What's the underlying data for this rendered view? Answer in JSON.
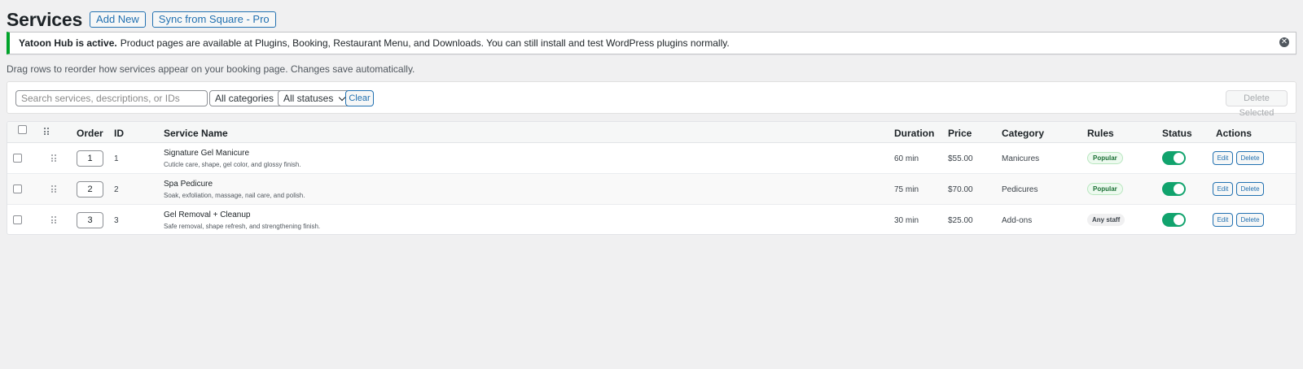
{
  "header": {
    "title": "Services",
    "add_new": "Add New",
    "sync": "Sync from Square - Pro"
  },
  "notice": {
    "strong": "Yatoon Hub is active.",
    "text": "Product pages are available at Plugins, Booking, Restaurant Menu, and Downloads. You can still install and test WordPress plugins normally.",
    "dismiss_glyph": "✕",
    "accent": "#00a32a"
  },
  "help_text": "Drag rows to reorder how services appear on your booking page. Changes save automatically.",
  "filters": {
    "search_placeholder": "Search services, descriptions, or IDs",
    "category": "All categories",
    "status": "All statuses",
    "clear": "Clear",
    "delete_selected": "Delete Selected"
  },
  "table": {
    "columns": {
      "order": "Order",
      "id": "ID",
      "name": "Service Name",
      "duration": "Duration",
      "price": "Price",
      "category": "Category",
      "rules": "Rules",
      "status": "Status",
      "actions": "Actions"
    },
    "rows": [
      {
        "order": "1",
        "id": "1",
        "name": "Signature Gel Manicure",
        "description": "Cuticle care, shape, gel color, and glossy finish.",
        "duration": "60 min",
        "price": "$55.00",
        "category": "Manicures",
        "rule": "Popular",
        "status_on": true,
        "edit": "Edit",
        "delete": "Delete"
      },
      {
        "order": "2",
        "id": "2",
        "name": "Spa Pedicure",
        "description": "Soak, exfoliation, massage, nail care, and polish.",
        "duration": "75 min",
        "price": "$70.00",
        "category": "Pedicures",
        "rule": "Popular",
        "status_on": true,
        "edit": "Edit",
        "delete": "Delete"
      },
      {
        "order": "3",
        "id": "3",
        "name": "Gel Removal + Cleanup",
        "description": "Safe removal, shape refresh, and strengthening finish.",
        "duration": "30 min",
        "price": "$25.00",
        "category": "Add-ons",
        "rule": "Any staff",
        "status_on": true,
        "edit": "Edit",
        "delete": "Delete"
      }
    ]
  },
  "colors": {
    "link": "#2271b1",
    "toggle_on": "#11a36d",
    "popular_bg": "#edfaef",
    "popular_text": "#1b6f35"
  }
}
